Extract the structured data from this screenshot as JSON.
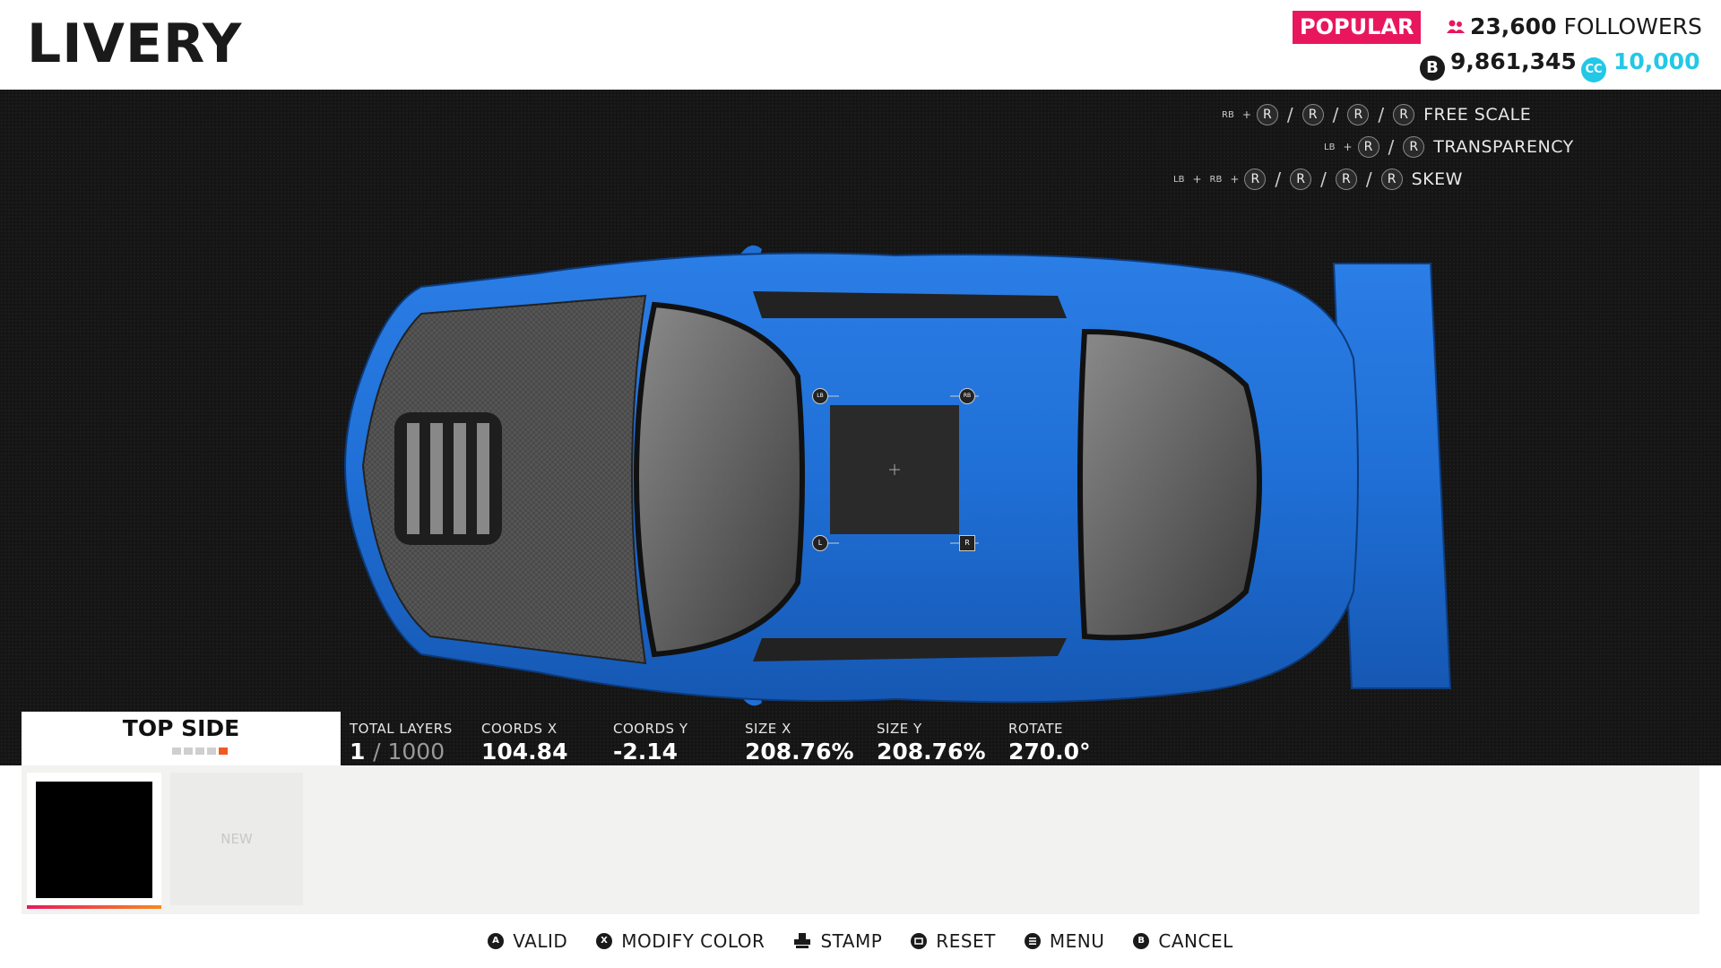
{
  "header": {
    "title": "LIVERY",
    "badge": "POPULAR",
    "followers_count": "23,600",
    "followers_label": "FOLLOWERS",
    "credits": "9,861,345",
    "credits_icon": "B",
    "cc_amount": "10,000",
    "cc_icon": "CC"
  },
  "hints": [
    {
      "buttons": [
        "RB"
      ],
      "label": "FREE SCALE"
    },
    {
      "buttons": [
        "LB"
      ],
      "label": "TRANSPARENCY"
    },
    {
      "buttons": [
        "LB",
        "RB"
      ],
      "label": "SKEW"
    }
  ],
  "stick": "R",
  "handles": {
    "top_left": "LB",
    "top_right": "RB",
    "bottom_left": "L",
    "bottom_right": "R"
  },
  "layer_tab": {
    "title": "TOP SIDE"
  },
  "stats": {
    "total_layers_label": "TOTAL LAYERS",
    "total_layers_value": "1",
    "total_layers_max": "/ 1000",
    "coords_x_label": "COORDS X",
    "coords_x_value": "104.84",
    "coords_y_label": "COORDS Y",
    "coords_y_value": "-2.14",
    "size_x_label": "SIZE X",
    "size_x_value": "208.76%",
    "size_y_label": "SIZE Y",
    "size_y_value": "208.76%",
    "rotate_label": "ROTATE",
    "rotate_value": "270.0°"
  },
  "strip": {
    "new_label": "NEW"
  },
  "footer": [
    {
      "icon": "A",
      "label": "VALID"
    },
    {
      "icon": "X",
      "label": "MODIFY COLOR"
    },
    {
      "icon": "stamp",
      "label": "STAMP"
    },
    {
      "icon": "reset",
      "label": "RESET"
    },
    {
      "icon": "menu",
      "label": "MENU"
    },
    {
      "icon": "B",
      "label": "CANCEL"
    }
  ],
  "colors": {
    "car_body": "#1f6fd6",
    "popular": "#e8175d",
    "cc": "#22c8e6",
    "accent": "#f05a22"
  }
}
